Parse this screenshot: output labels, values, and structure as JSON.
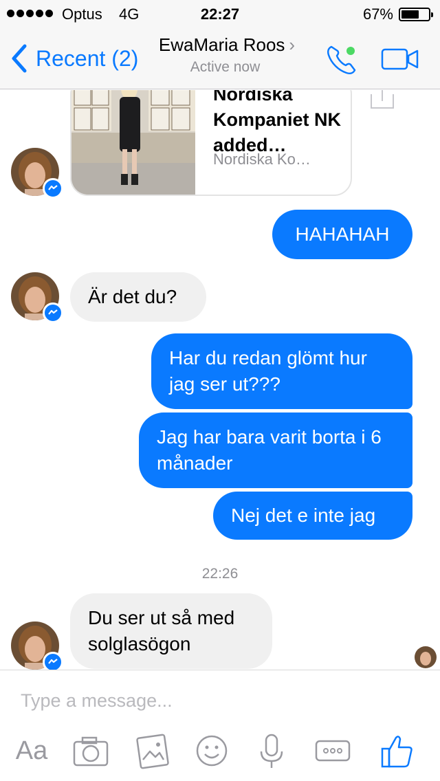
{
  "status_bar": {
    "carrier": "Optus",
    "network": "4G",
    "time": "22:27",
    "battery_percent_label": "67%",
    "battery_level": 0.67
  },
  "nav": {
    "back_label": "Recent (2)",
    "contact_name": "EwaMaria Roos",
    "contact_chevron": "›",
    "contact_status": "Active now",
    "online_color": "#4cd964",
    "accent_color": "#0a7aff"
  },
  "chat": {
    "link_card": {
      "title": "Nordiska Kompaniet NK added…",
      "source": "Nordiska Ko…"
    },
    "messages": [
      {
        "sender": "me",
        "text": "HAHAHAH"
      },
      {
        "sender": "contact",
        "text": "Är det du?"
      },
      {
        "sender": "me",
        "text": "Har du redan glömt hur jag ser ut???"
      },
      {
        "sender": "me",
        "text": "Jag har bara varit borta i 6 månader"
      },
      {
        "sender": "me",
        "text": "Nej det e inte jag"
      },
      {
        "sender": "contact",
        "text": "Du ser ut så med solglasögon"
      }
    ],
    "timestamp": "22:26"
  },
  "composer": {
    "placeholder": "Type a message...",
    "aa_label": "Aa",
    "icons": [
      "text-format-icon",
      "camera-icon",
      "photo-gallery-icon",
      "emoji-icon",
      "microphone-icon",
      "more-icon",
      "like-icon"
    ]
  }
}
